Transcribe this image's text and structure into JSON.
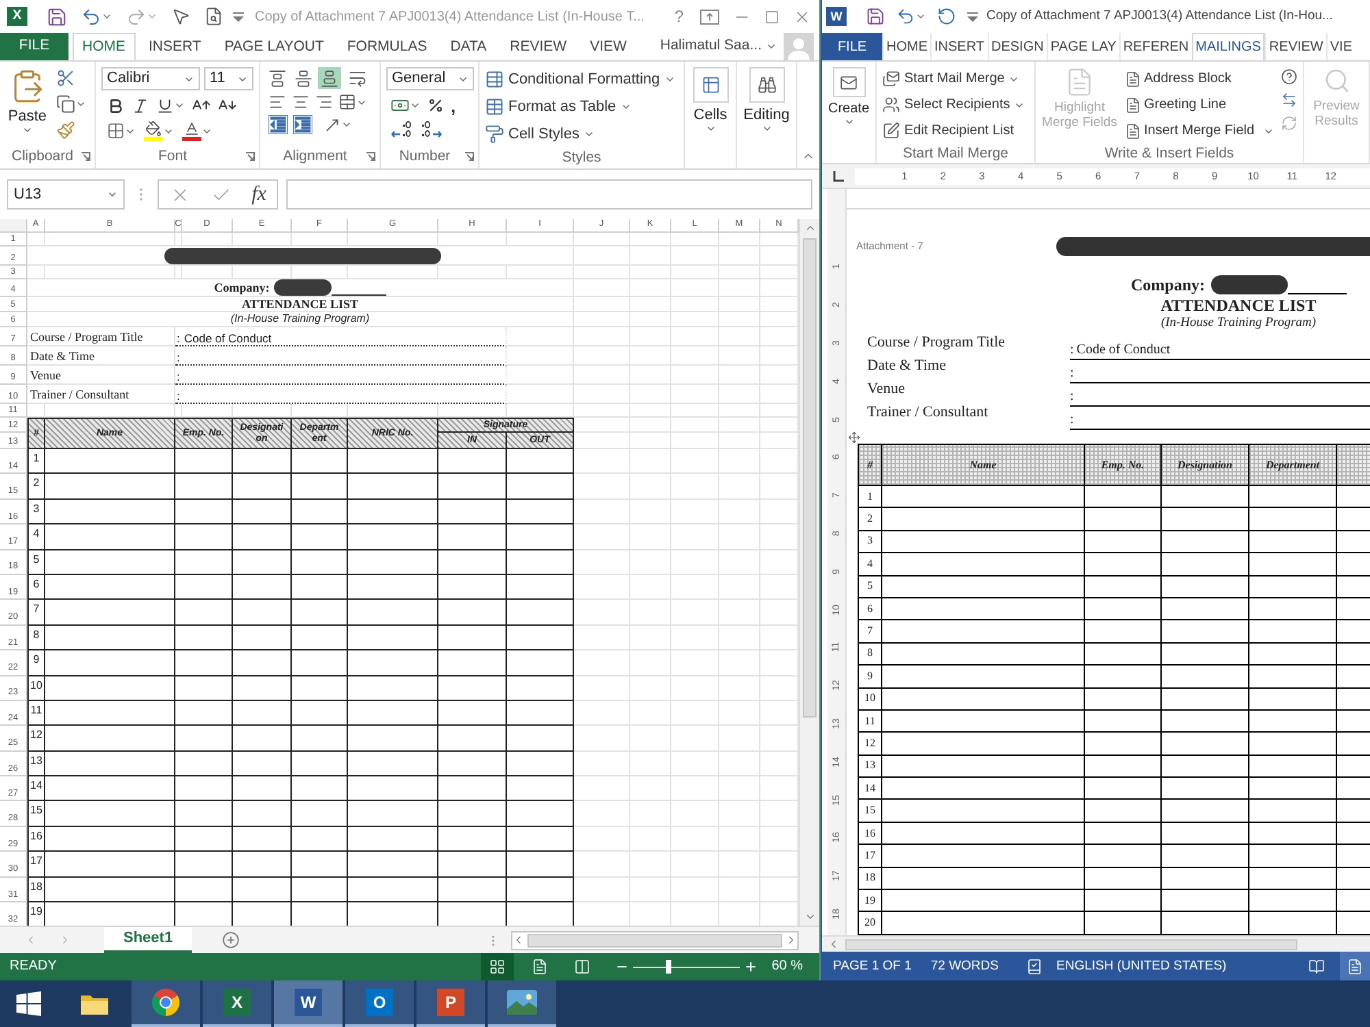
{
  "excel": {
    "app_letter": "X",
    "title": "Copy of Attachment 7 APJ0013(4) Attendance List (In-House T...",
    "help": "?",
    "tabs": [
      {
        "label": "FILE",
        "kind": "file",
        "selected": false
      },
      {
        "label": "HOME",
        "kind": "tab",
        "selected": true
      },
      {
        "label": "INSERT",
        "kind": "tab",
        "selected": false
      },
      {
        "label": "PAGE LAYOUT",
        "kind": "tab",
        "selected": false
      },
      {
        "label": "FORMULAS",
        "kind": "tab",
        "selected": false
      },
      {
        "label": "DATA",
        "kind": "tab",
        "selected": false
      },
      {
        "label": "REVIEW",
        "kind": "tab",
        "selected": false
      },
      {
        "label": "VIEW",
        "kind": "tab",
        "selected": false
      }
    ],
    "user": "Halimatul Saa...",
    "ribbon": {
      "paste": "Paste",
      "font_name": "Calibri",
      "font_size": "11",
      "vertical_align": [
        {
          "selected": false
        },
        {
          "selected": false
        },
        {
          "selected": true
        }
      ],
      "number_format": "General",
      "comma": ",",
      "styles": [
        "Conditional Formatting",
        "Format as Table",
        "Cell Styles"
      ],
      "cells": "Cells",
      "editing": "Editing",
      "groups": [
        "Clipboard",
        "Font",
        "Alignment",
        "Number",
        "Styles"
      ]
    },
    "name_box": "U13",
    "function_label": "fx",
    "columns": [
      "A",
      "B",
      "C",
      "D",
      "E",
      "F",
      "G",
      "H",
      "I",
      "J",
      "K",
      "L",
      "M",
      "N"
    ],
    "row_numbers": [
      "1",
      "2",
      "3",
      "4",
      "5",
      "6",
      "7",
      "8",
      "9",
      "10",
      "11",
      "12",
      "13",
      "14",
      "15",
      "16",
      "17",
      "18",
      "19",
      "20",
      "21",
      "22",
      "23",
      "24",
      "25",
      "26",
      "27",
      "28",
      "29",
      "30",
      "31",
      "32"
    ],
    "sheet": {
      "company": "Company:",
      "heading": "ATTENDANCE LIST",
      "subheading": "(In-House Training Program)",
      "fields": [
        {
          "label": "Course / Program Title",
          "colon": ":",
          "value": "Code of Conduct"
        },
        {
          "label": "Date & Time",
          "colon": ":"
        },
        {
          "label": "Venue",
          "colon": ":"
        },
        {
          "label": "Trainer / Consultant",
          "colon": ":"
        }
      ],
      "table_headers": [
        "#",
        "Name",
        "Emp. No.",
        "Designation",
        "Department",
        "NRIC No."
      ],
      "signature": "Signature",
      "signature_columns": [
        "IN",
        "OUT"
      ],
      "row_labels": [
        "1",
        "2",
        "3",
        "4",
        "5",
        "6",
        "7",
        "8",
        "9",
        "10",
        "11",
        "12",
        "13",
        "14",
        "15",
        "16",
        "17",
        "18",
        "19"
      ]
    },
    "sheet_tabs": [
      {
        "label": "Sheet1",
        "selected": true
      }
    ],
    "status": "READY",
    "view_buttons": [
      {
        "selected": true
      },
      {
        "selected": false
      },
      {
        "selected": false
      }
    ],
    "zoom": {
      "level": 0.33,
      "reading": "60 %"
    }
  },
  "word": {
    "app_letter": "W",
    "title": "Copy of Attachment 7 APJ0013(4) Attendance List (In-Hou...",
    "tabs": [
      {
        "label": "FILE",
        "kind": "file",
        "selected": false
      },
      {
        "label": "HOME",
        "kind": "tab",
        "selected": false
      },
      {
        "label": "INSERT",
        "kind": "tab",
        "selected": false
      },
      {
        "label": "DESIGN",
        "kind": "tab",
        "selected": false
      },
      {
        "label": "PAGE LAY",
        "kind": "tab",
        "selected": false
      },
      {
        "label": "REFEREN",
        "kind": "tab",
        "selected": false
      },
      {
        "label": "MAILINGS",
        "kind": "tab",
        "selected": true
      },
      {
        "label": "REVIEW",
        "kind": "tab",
        "selected": false
      },
      {
        "label": "VIE",
        "kind": "tab",
        "selected": false
      }
    ],
    "ribbon": {
      "create": "Create",
      "start": [
        "Start Mail Merge",
        "Select Recipients",
        "Edit Recipient List"
      ],
      "highlight": {
        "label": "Highlight Merge Fields",
        "disabled": true
      },
      "fields": [
        "Address Block",
        "Greeting Line",
        "Insert Merge Field"
      ],
      "preview": {
        "label": "Preview Results",
        "disabled": true
      },
      "groups": [
        "Start Mail Merge",
        "Write & Insert Fields"
      ]
    },
    "ruler": [
      "1",
      "2",
      "3",
      "4",
      "5",
      "6",
      "7",
      "8",
      "9",
      "10",
      "11",
      "12"
    ],
    "vertical_ruler": [
      "1",
      "2",
      "3",
      "4",
      "5",
      "6",
      "7",
      "8",
      "9",
      "10",
      "11",
      "12",
      "13",
      "14",
      "15",
      "16",
      "17",
      "18"
    ],
    "document": {
      "attachment": "Attachment - 7",
      "company": "Company:",
      "heading": "ATTENDANCE LIST",
      "subheading": "(In-House Training Program)",
      "fields": [
        {
          "label": "Course / Program Title",
          "colon": ":",
          "value": "Code of Conduct"
        },
        {
          "label": "Date & Time",
          "colon": ":"
        },
        {
          "label": "Venue",
          "colon": ":"
        },
        {
          "label": "Trainer / Consultant",
          "colon": ":"
        }
      ],
      "table_headers": [
        "#",
        "Name",
        "Emp. No.",
        "Designation",
        "Department"
      ],
      "row_labels": [
        "1",
        "2",
        "3",
        "4",
        "5",
        "6",
        "7",
        "8",
        "9",
        "10",
        "11",
        "12",
        "13",
        "14",
        "15",
        "16",
        "17",
        "18",
        "19",
        "20"
      ]
    },
    "status": {
      "page": "PAGE 1 OF 1",
      "words": "72 WORDS",
      "language": "ENGLISH (UNITED STATES)",
      "view_buttons": [
        {
          "selected": false
        },
        {
          "selected": true
        }
      ]
    }
  },
  "taskbar": {
    "apps": [
      {
        "kind": "explorer",
        "open": false,
        "selected": false
      },
      {
        "kind": "browser",
        "open": true,
        "selected": false
      },
      {
        "kind": "letter",
        "letter": "X",
        "color": "#1e7145",
        "open": true,
        "selected": false
      },
      {
        "kind": "letter",
        "letter": "W",
        "color": "#2b5797",
        "open": true,
        "selected": true
      },
      {
        "kind": "letter",
        "letter": "O",
        "color": "#0072c6",
        "open": true,
        "selected": false
      },
      {
        "kind": "letter",
        "letter": "P",
        "color": "#d24726",
        "open": true,
        "selected": false
      },
      {
        "kind": "photos",
        "open": true,
        "selected": false
      }
    ]
  }
}
